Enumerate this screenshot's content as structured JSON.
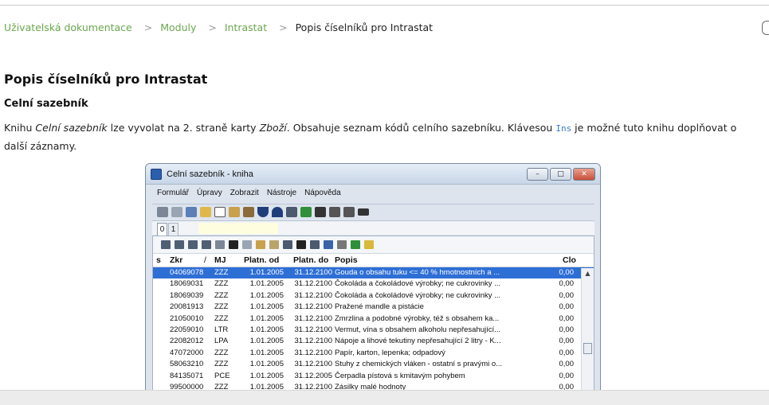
{
  "breadcrumb": {
    "items": [
      "Uživatelská dokumentace",
      "Moduly",
      "Intrastat"
    ],
    "separator": ">",
    "current": "Popis číselníků pro Intrastat"
  },
  "page_title": "Popis číselníků pro Intrastat",
  "section_title": "Celní sazebník",
  "paragraph": {
    "p1": "Knihu ",
    "em1": "Celní sazebník",
    "p2": " lze vyvolat na 2. straně karty ",
    "em2": "Zboží",
    "p3": ". Obsahuje seznam kódů celního sazebníku. Klávesou ",
    "key": "Ins",
    "p4": " je možné tuto knihu doplňovat o další záznamy."
  },
  "window": {
    "title": "Celní sazebník - kniha",
    "menu": [
      "Formulář",
      "Úpravy",
      "Zobrazit",
      "Nástroje",
      "Nápověda"
    ],
    "tabs": [
      "0",
      "1"
    ],
    "columns": {
      "s": "s",
      "zkr": "Zkr",
      "sort": "/",
      "mj": "MJ",
      "od": "Platn. od",
      "do": "Platn. do",
      "popis": "Popis",
      "clo": "Clo"
    },
    "rows": [
      {
        "zkr": "04069078",
        "mj": "ZZZ",
        "od": "1.01.2005",
        "do": "31.12.2100",
        "popis": "Gouda o obsahu tuku <= 40 % hmotnostních a ...",
        "clo": "0,00"
      },
      {
        "zkr": "18069031",
        "mj": "ZZZ",
        "od": "1.01.2005",
        "do": "31.12.2100",
        "popis": "Čokoláda a čokoládové výrobky; ne cukrovinky ...",
        "clo": "0,00"
      },
      {
        "zkr": "18069039",
        "mj": "ZZZ",
        "od": "1.01.2005",
        "do": "31.12.2100",
        "popis": "Čokoláda a čokoládové výrobky; ne cukrovinky ...",
        "clo": "0,00"
      },
      {
        "zkr": "20081913",
        "mj": "ZZZ",
        "od": "1.01.2005",
        "do": "31.12.2100",
        "popis": "Pražené mandle a pistácie",
        "clo": "0,00"
      },
      {
        "zkr": "21050010",
        "mj": "ZZZ",
        "od": "1.01.2005",
        "do": "31.12.2100",
        "popis": "Zmrzlina a podobné výrobky, též s obsahem ka...",
        "clo": "0,00"
      },
      {
        "zkr": "22059010",
        "mj": "LTR",
        "od": "1.01.2005",
        "do": "31.12.2100",
        "popis": "Vermut, vína s obsahem alkoholu nepřesahující...",
        "clo": "0,00"
      },
      {
        "zkr": "22082012",
        "mj": "LPA",
        "od": "1.01.2005",
        "do": "31.12.2100",
        "popis": "Nápoje a lihové tekutiny nepřesahující 2 litry - K...",
        "clo": "0,00"
      },
      {
        "zkr": "47072000",
        "mj": "ZZZ",
        "od": "1.01.2005",
        "do": "31.12.2100",
        "popis": "Papír, karton, lepenka; odpadový",
        "clo": "0,00"
      },
      {
        "zkr": "58063210",
        "mj": "ZZZ",
        "od": "1.01.2005",
        "do": "31.12.2100",
        "popis": "Stuhy z chemických vláken - ostatní s pravými o...",
        "clo": "0,00"
      },
      {
        "zkr": "84135071",
        "mj": "PCE",
        "od": "1.01.2005",
        "do": "31.12.2005",
        "popis": "Čerpadla pístová s kmitavým pohybem",
        "clo": "0,00"
      },
      {
        "zkr": "99500000",
        "mj": "ZZZ",
        "od": "1.01.2005",
        "do": "31.12.2100",
        "popis": "Zásilky malé hodnoty",
        "clo": "0,00"
      }
    ]
  },
  "colors": {
    "link": "#6aa84f",
    "key": "#3b7bbf",
    "selection": "#2e6fd6"
  }
}
